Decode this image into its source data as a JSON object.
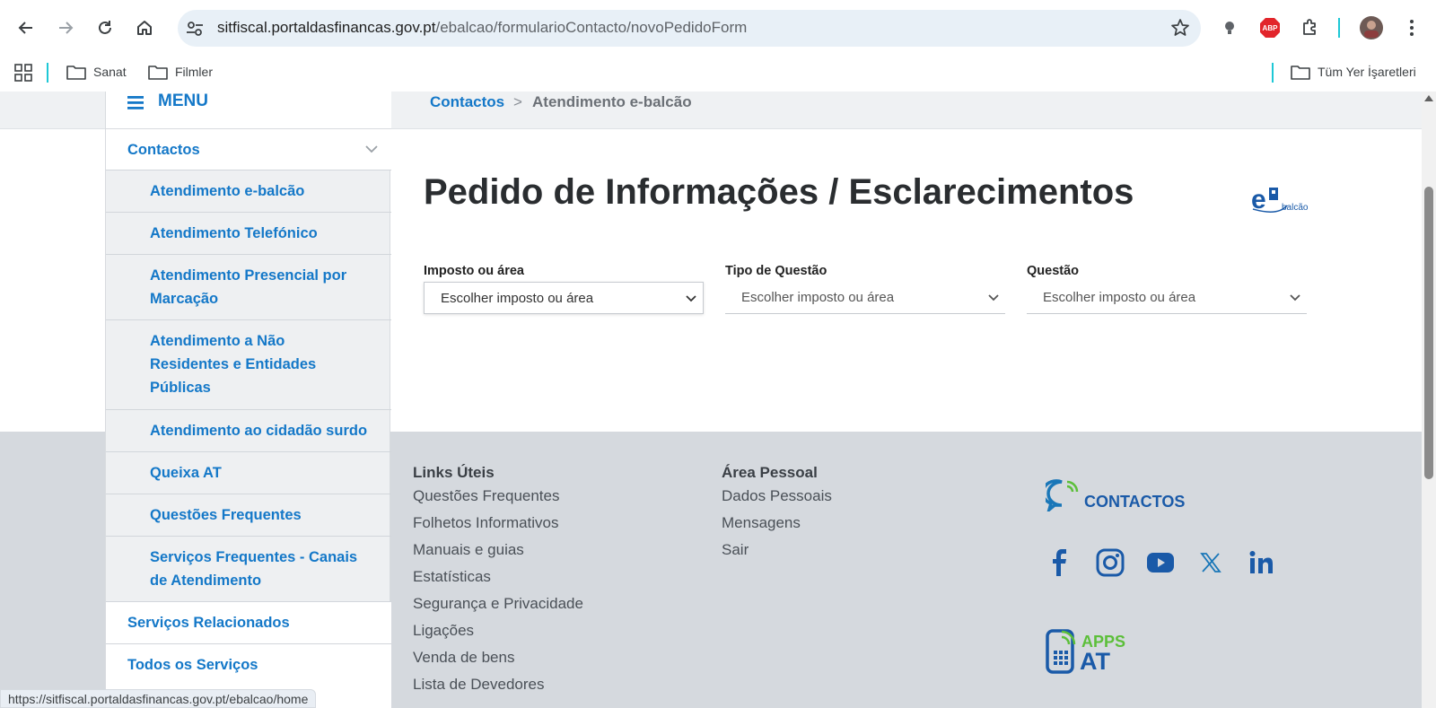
{
  "browser": {
    "url_host": "sitfiscal.portaldasfinancas.gov.pt",
    "url_path": "/ebalcao/formularioContacto/novoPedidoForm",
    "bookmarks": [
      "Sanat",
      "Filmler"
    ],
    "all_bookmarks": "Tüm Yer İşaretleri",
    "abp_label": "ABP",
    "status_url": "https://sitfiscal.portaldasfinancas.gov.pt/ebalcao/home"
  },
  "sidebar": {
    "menu_label": "MENU",
    "section": "Contactos",
    "sub_items": [
      "Atendimento e-balcão",
      "Atendimento Telefónico",
      "Atendimento Presencial por Marcação",
      "Atendimento a Não Residentes e Entidades Públicas",
      "Atendimento ao cidadão surdo",
      "Queixa AT",
      "Questões Frequentes",
      "Serviços Frequentes - Canais de Atendimento"
    ],
    "bottom_items": [
      "Serviços Relacionados",
      "Todos os Serviços"
    ]
  },
  "breadcrumb": {
    "parent": "Contactos",
    "separator": ">",
    "current": "Atendimento e-balcão"
  },
  "main": {
    "title": "Pedido de Informações / Esclarecimentos",
    "logo_text": "balcão",
    "fields": [
      {
        "label": "Imposto ou área",
        "value": "Escolher imposto ou área"
      },
      {
        "label": "Tipo de Questão",
        "value": "Escolher imposto ou área"
      },
      {
        "label": "Questão",
        "value": "Escolher imposto ou área"
      }
    ]
  },
  "footer": {
    "links_title": "Links Úteis",
    "links": [
      "Questões Frequentes",
      "Folhetos Informativos",
      "Manuais e guias",
      "Estatísticas",
      "Segurança e Privacidade",
      "Ligações",
      "Venda de bens",
      "Lista de Devedores"
    ],
    "personal_title": "Área Pessoal",
    "personal_links": [
      "Dados Pessoais",
      "Mensagens",
      "Sair"
    ],
    "contactos_label": "CONTACTOS",
    "apps_label_1": "APPS",
    "apps_label_2": "AT",
    "social": [
      "facebook-icon",
      "instagram-icon",
      "youtube-icon",
      "x-icon",
      "linkedin-icon"
    ]
  },
  "colors": {
    "brand_blue": "#1478c8",
    "footer_bg": "#d5d9de",
    "sidebar_bg": "#eef0f2",
    "omnibox_bg": "#e8f0f7"
  }
}
